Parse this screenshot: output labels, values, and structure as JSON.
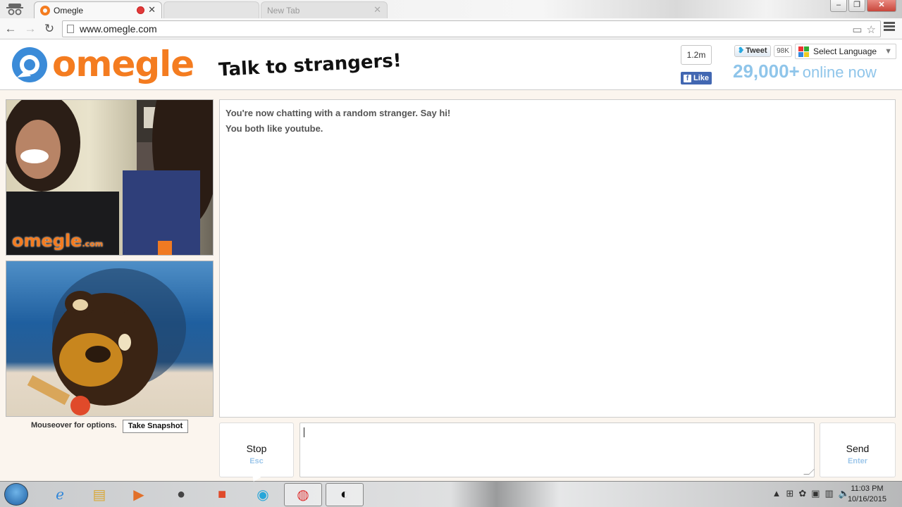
{
  "browser": {
    "tabs": [
      {
        "title": "Omegle"
      },
      {
        "title": ""
      },
      {
        "title": "New Tab"
      }
    ],
    "url": "www.omegle.com"
  },
  "header": {
    "logo_text": "omegle",
    "tagline": "Talk to strangers!",
    "facebook": {
      "count": "1.2m",
      "like_label": "Like"
    },
    "twitter": {
      "tweet_label": "Tweet",
      "count": "98K"
    },
    "language": {
      "label": "Select Language"
    },
    "online": {
      "count": "29,000+",
      "label": "online now"
    },
    "colors": {
      "brand": "#f47c20",
      "online": "#8fc5ea"
    }
  },
  "video": {
    "watermark": "omegle",
    "watermark_suffix": ".com",
    "options_text": "Mouseover for options.",
    "snapshot_label": "Take Snapshot"
  },
  "chat": {
    "messages": [
      "You're now chatting with a random stranger. Say hi!",
      "You both like youtube."
    ],
    "input_value": "",
    "stop": {
      "label": "Stop",
      "shortcut": "Esc"
    },
    "send": {
      "label": "Send",
      "shortcut": "Enter"
    }
  },
  "taskbar": {
    "icons": [
      "start-icon",
      "ie-icon",
      "explorer-icon",
      "media-player-icon",
      "hp-icon",
      "office-icon",
      "app-icon",
      "chrome-icon",
      "obs-icon"
    ],
    "time": "11:03 PM",
    "date": "10/16/2015"
  }
}
